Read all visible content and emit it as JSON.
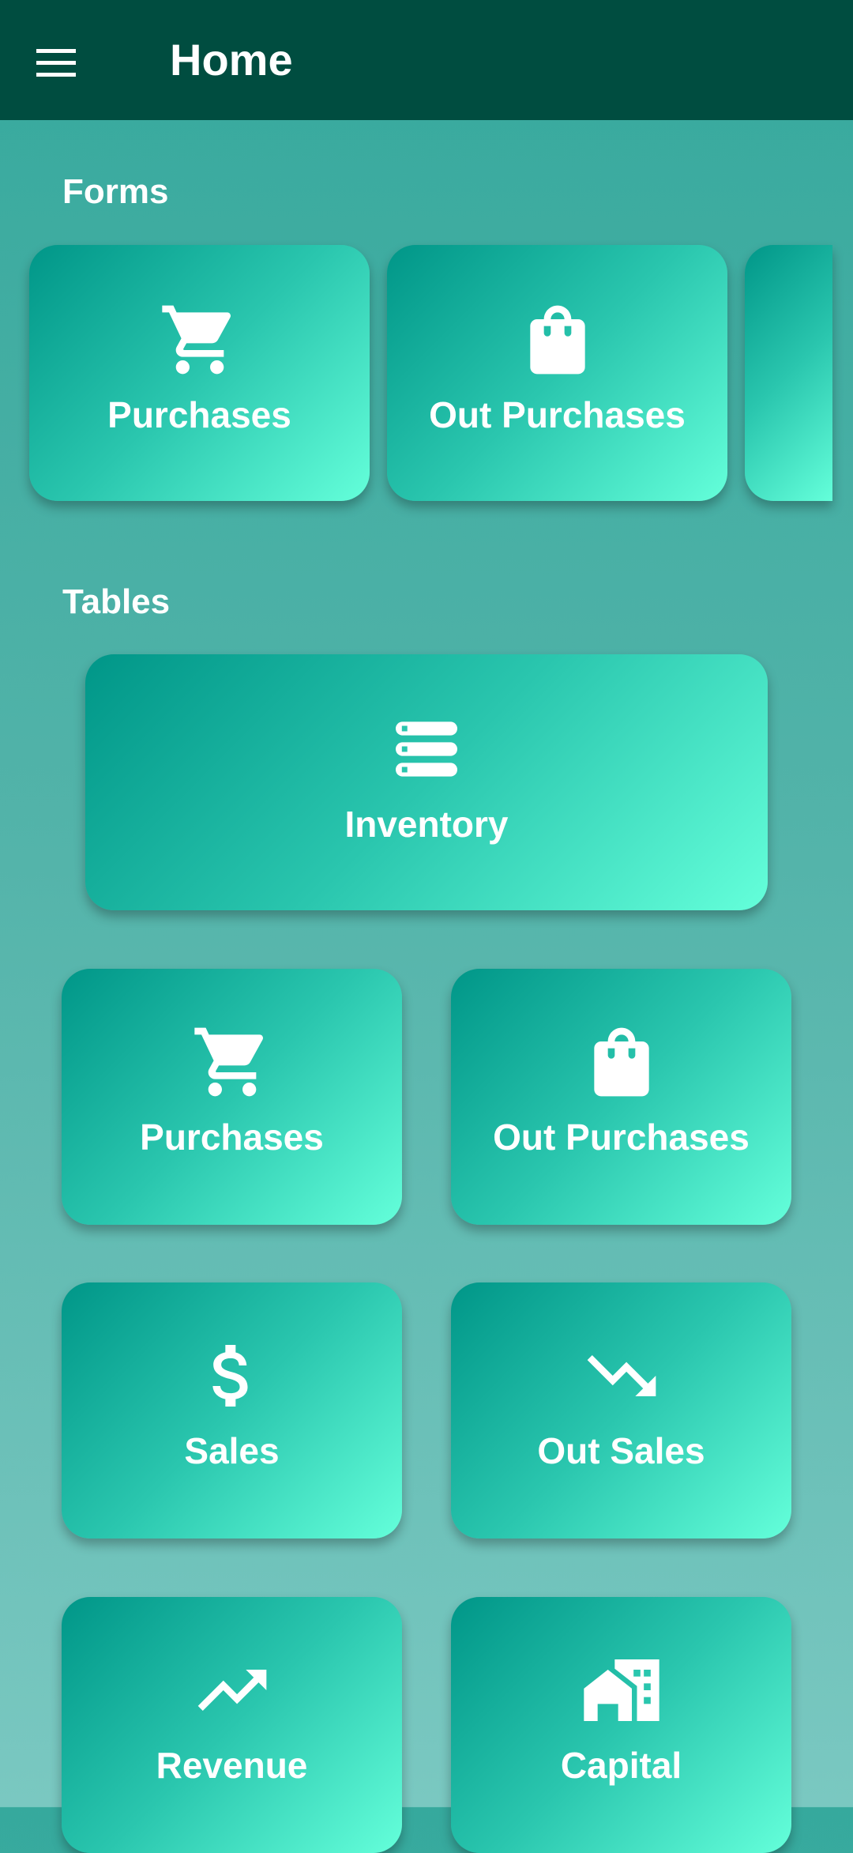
{
  "app_bar": {
    "title": "Home",
    "menu_icon": "menu-icon",
    "background": "#004d40"
  },
  "forms": {
    "heading": "Forms",
    "cards": [
      {
        "label": "Purchases",
        "icon": "shopping-cart-icon"
      },
      {
        "label": "Out Purchases",
        "icon": "shopping-bag-icon"
      },
      {
        "label": "",
        "icon": ""
      }
    ]
  },
  "tables": {
    "heading": "Tables",
    "cards": [
      {
        "label": "Inventory",
        "icon": "storage-icon"
      },
      {
        "label": "Purchases",
        "icon": "shopping-cart-icon"
      },
      {
        "label": "Out Purchases",
        "icon": "shopping-bag-icon"
      },
      {
        "label": "Sales",
        "icon": "dollar-icon"
      },
      {
        "label": "Out Sales",
        "icon": "trending-down-icon"
      },
      {
        "label": "Revenue",
        "icon": "trending-up-icon"
      },
      {
        "label": "Capital",
        "icon": "home-work-icon"
      }
    ]
  },
  "colors": {
    "card_gradient_start": "#009688",
    "card_gradient_end": "#64ffda",
    "text": "#ffffff"
  }
}
